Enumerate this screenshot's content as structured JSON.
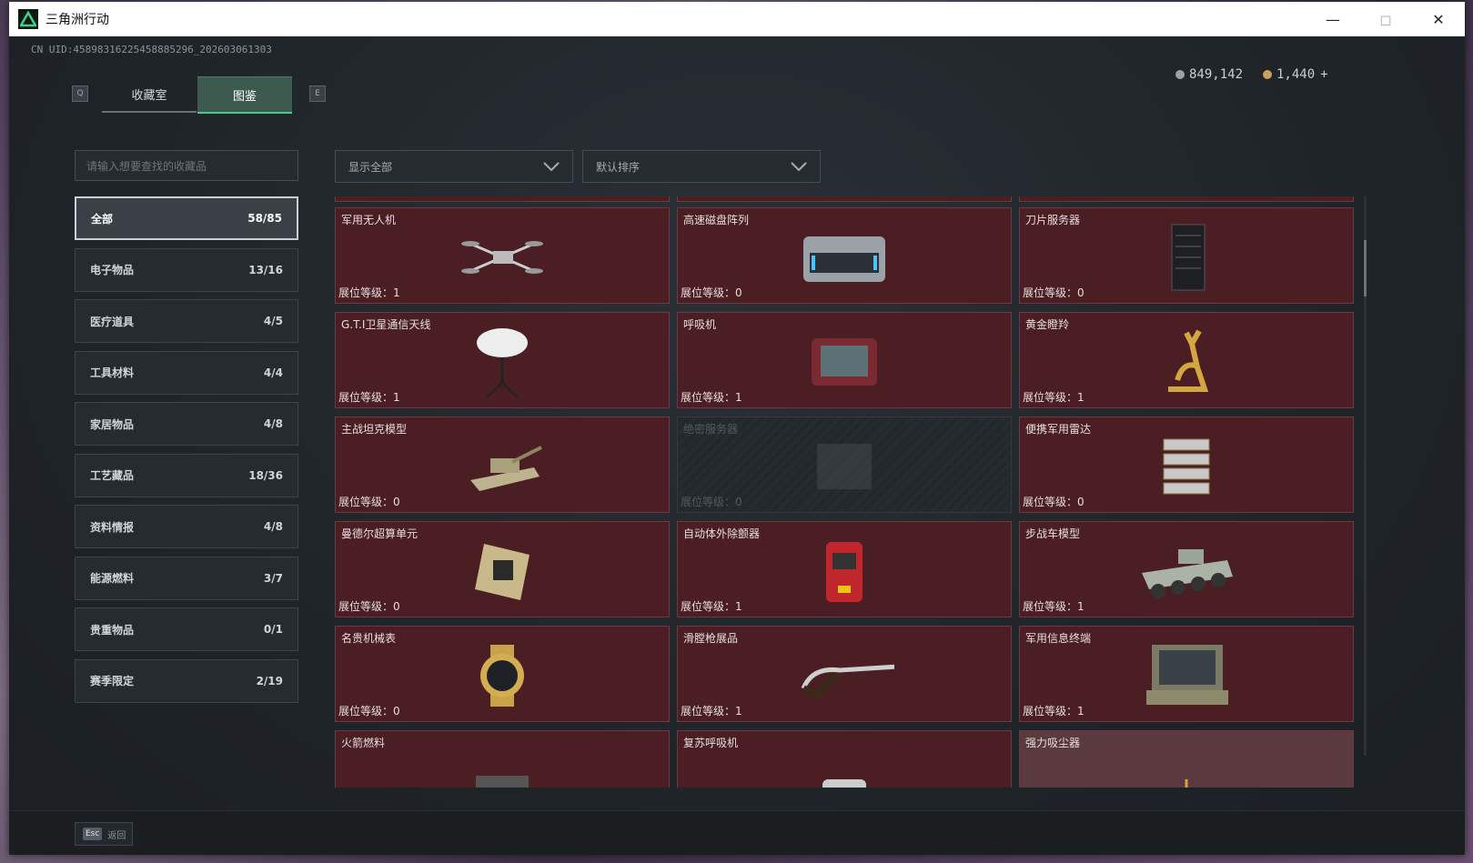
{
  "window": {
    "title": "三角洲行动"
  },
  "uid": "CN UID:4589831622545888529​6_202603061303",
  "tabs": {
    "left_key": "Q",
    "right_key": "E",
    "collection_room": "收藏室",
    "catalog": "图鉴"
  },
  "currency": {
    "silver": "849,142",
    "gold": "1,440",
    "add": "+"
  },
  "search": {
    "placeholder": "请输入想要查找的收藏品"
  },
  "categories": [
    {
      "label": "全部",
      "count": "58/85"
    },
    {
      "label": "电子物品",
      "count": "13/16"
    },
    {
      "label": "医疗道具",
      "count": "4/5"
    },
    {
      "label": "工具材料",
      "count": "4/4"
    },
    {
      "label": "家居物品",
      "count": "4/8"
    },
    {
      "label": "工艺藏品",
      "count": "18/36"
    },
    {
      "label": "资料情报",
      "count": "4/8"
    },
    {
      "label": "能源燃料",
      "count": "3/7"
    },
    {
      "label": "贵重物品",
      "count": "0/1"
    },
    {
      "label": "赛季限定",
      "count": "2/19"
    }
  ],
  "filters": {
    "show": "显示全部",
    "sort": "默认排序"
  },
  "level_label": "展位等级：",
  "items": [
    {
      "name": "军用无人机",
      "level": "1",
      "icon": "drone-icon"
    },
    {
      "name": "高速磁盘阵列",
      "level": "0",
      "icon": "disk-array-icon"
    },
    {
      "name": "刀片服务器",
      "level": "0",
      "icon": "blade-server-icon"
    },
    {
      "name": "G.T.I卫星通信天线",
      "level": "1",
      "icon": "satellite-antenna-icon"
    },
    {
      "name": "呼吸机",
      "level": "1",
      "icon": "ventilator-icon"
    },
    {
      "name": "黄金瞪羚",
      "level": "1",
      "icon": "golden-gazelle-icon"
    },
    {
      "name": "主战坦克模型",
      "level": "0",
      "icon": "tank-model-icon"
    },
    {
      "name": "绝密服务器",
      "level": "0",
      "icon": "secret-server-icon"
    },
    {
      "name": "便携军用雷达",
      "level": "0",
      "icon": "portable-radar-icon"
    },
    {
      "name": "曼德尔超算单元",
      "level": "0",
      "icon": "supercompute-unit-icon"
    },
    {
      "name": "自动体外除颤器",
      "level": "1",
      "icon": "defibrillator-icon"
    },
    {
      "name": "步战车模型",
      "level": "1",
      "icon": "ifv-model-icon"
    },
    {
      "name": "名贵机械表",
      "level": "0",
      "icon": "watch-icon"
    },
    {
      "name": "滑膛枪展品",
      "level": "1",
      "icon": "musket-icon"
    },
    {
      "name": "军用信息终端",
      "level": "1",
      "icon": "terminal-icon"
    },
    {
      "name": "火箭燃料",
      "level": "",
      "icon": "rocket-fuel-icon"
    },
    {
      "name": "复苏呼吸机",
      "level": "",
      "icon": "resuscitator-icon"
    },
    {
      "name": "强力吸尘器",
      "level": "",
      "icon": "vacuum-icon"
    }
  ],
  "footer": {
    "esc_key": "Esc",
    "back": "返回"
  }
}
